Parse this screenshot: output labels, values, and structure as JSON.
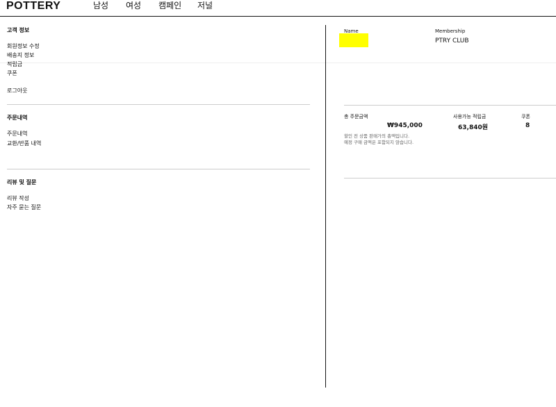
{
  "header": {
    "logo": "POTTERY",
    "nav": [
      "남성",
      "여성",
      "캠페인",
      "저널"
    ]
  },
  "sidebar": {
    "sections": [
      {
        "title": "고객 정보",
        "items": [
          "회원정보 수정",
          "배송지 정보",
          "적립금",
          "쿠폰",
          "로그아웃"
        ]
      },
      {
        "title": "주문내역",
        "items": [
          "주문내역",
          "교환/반품 내역"
        ]
      },
      {
        "title": "리뷰 및 질문",
        "items": [
          "리뷰 작성",
          "자주 묻는 질문"
        ]
      }
    ]
  },
  "profile": {
    "name_label": "Name",
    "membership_label": "Membership",
    "membership_value": "PTRY CLUB"
  },
  "summary": {
    "total_label": "총 주문금액",
    "total_value": "₩945,000",
    "points_label": "사용가능 적립금",
    "points_value": "63,840원",
    "coupon_label": "쿠폰",
    "coupon_value": "8",
    "note1": "할인 전 상품 판매가의 총액입니다.",
    "note2": "예정 구매 금액은 포함되지 않습니다."
  }
}
